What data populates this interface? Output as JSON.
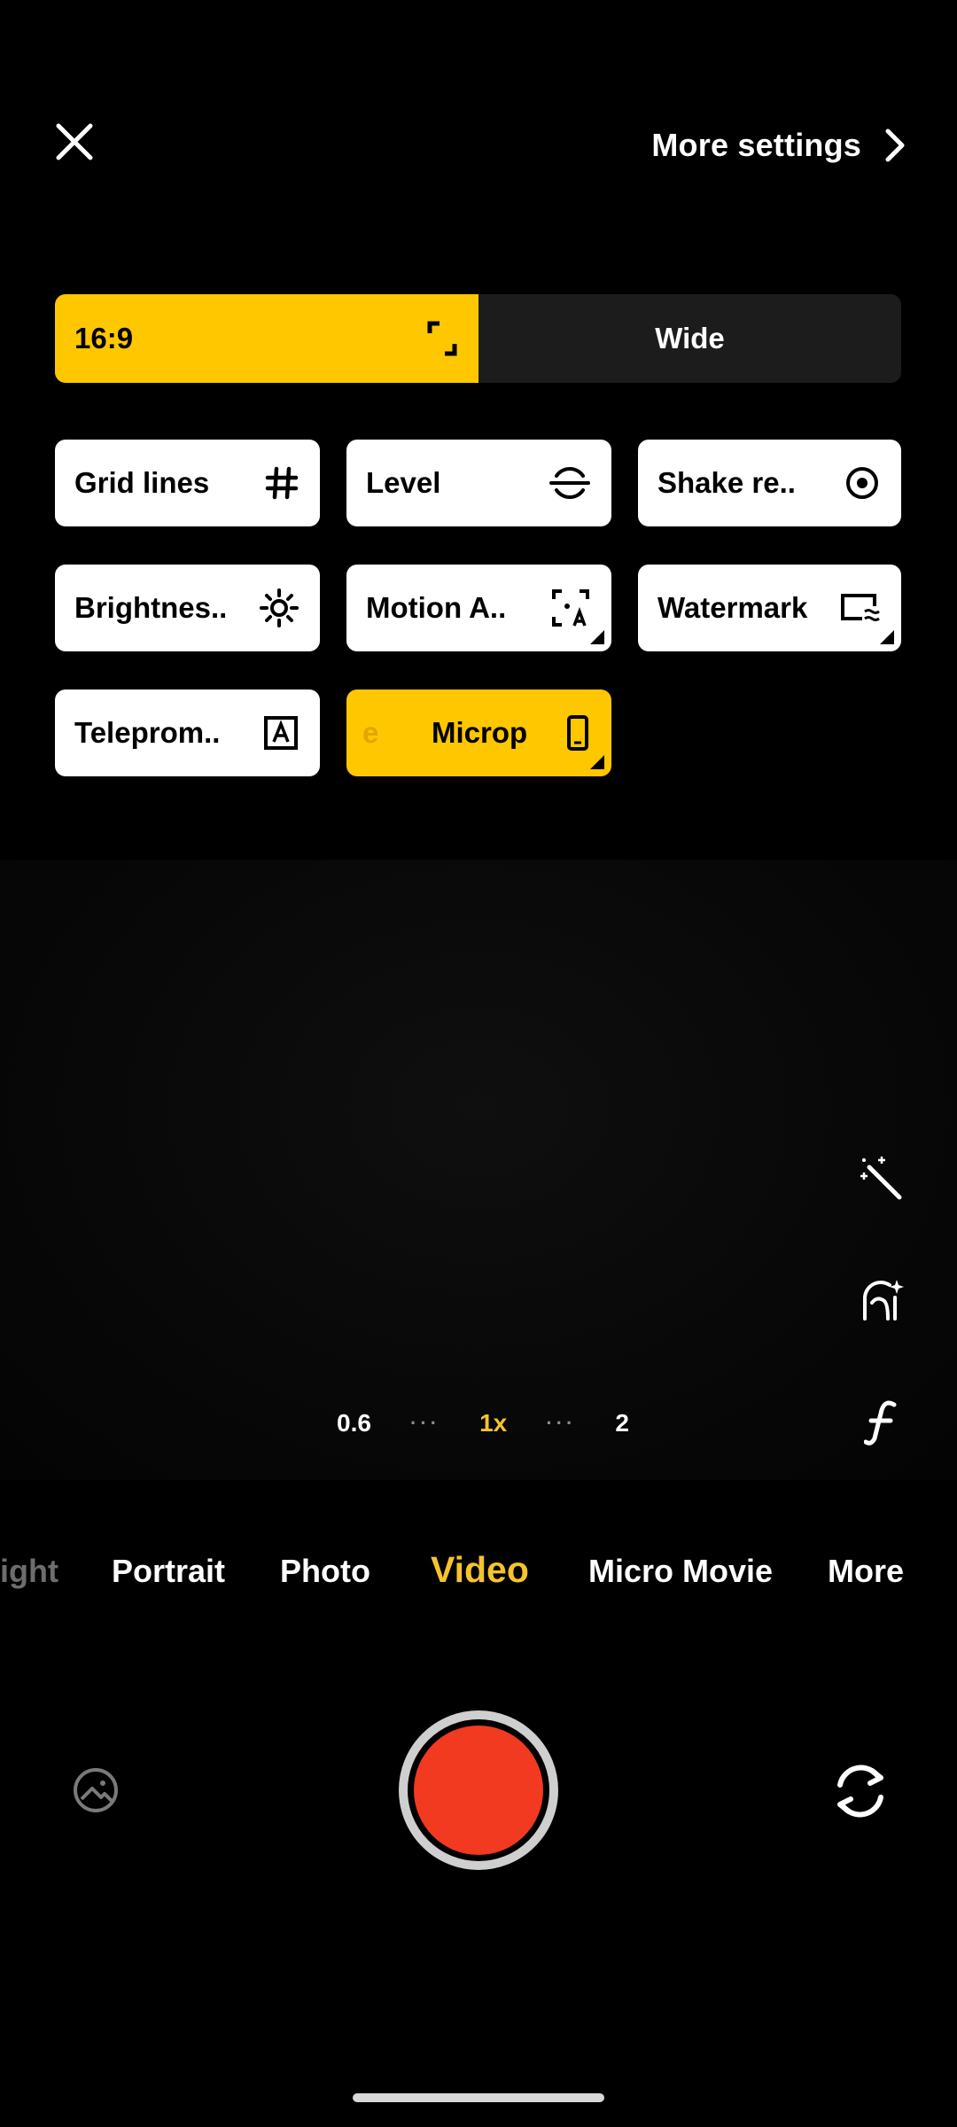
{
  "header": {
    "close_icon": "close-icon",
    "more_settings_label": "More settings",
    "more_settings_icon": "chevron-right-icon"
  },
  "aspect": {
    "selected_label": "16:9",
    "selected_icon": "expand-corners-icon",
    "other_label": "Wide"
  },
  "tiles": [
    {
      "label": "Grid lines",
      "icon": "grid-icon",
      "active": false
    },
    {
      "label": "Level",
      "icon": "level-icon",
      "active": false
    },
    {
      "label": "Shake re..",
      "icon": "target-circle-icon",
      "active": false
    },
    {
      "label": "Brightnes..",
      "icon": "sun-icon",
      "active": false
    },
    {
      "label": "Motion A..",
      "icon": "autofocus-a-icon",
      "active": false
    },
    {
      "label": "Watermark",
      "icon": "watermark-icon",
      "active": false
    },
    {
      "label": "Teleprom..",
      "icon": "text-box-icon",
      "active": false
    },
    {
      "label": "Microp",
      "prefix": "e",
      "icon": "phone-icon",
      "active": true
    }
  ],
  "side_tools": [
    "magic-wand-icon",
    "beauty-face-icon",
    "filter-f-icon"
  ],
  "zoom": {
    "left": "0.6",
    "active": "1x",
    "right": "2",
    "dots": "···"
  },
  "modes": {
    "partial": "ight",
    "portrait": "Portrait",
    "photo": "Photo",
    "video": "Video",
    "micro_movie": "Micro Movie",
    "more": "More"
  },
  "controls": {
    "gallery_icon": "gallery-icon",
    "shutter": "record-button",
    "switch_icon": "camera-switch-icon"
  },
  "colors": {
    "accent_yellow": "#fec700",
    "active_mode": "#f5c32d",
    "record_red": "#f23a21"
  }
}
